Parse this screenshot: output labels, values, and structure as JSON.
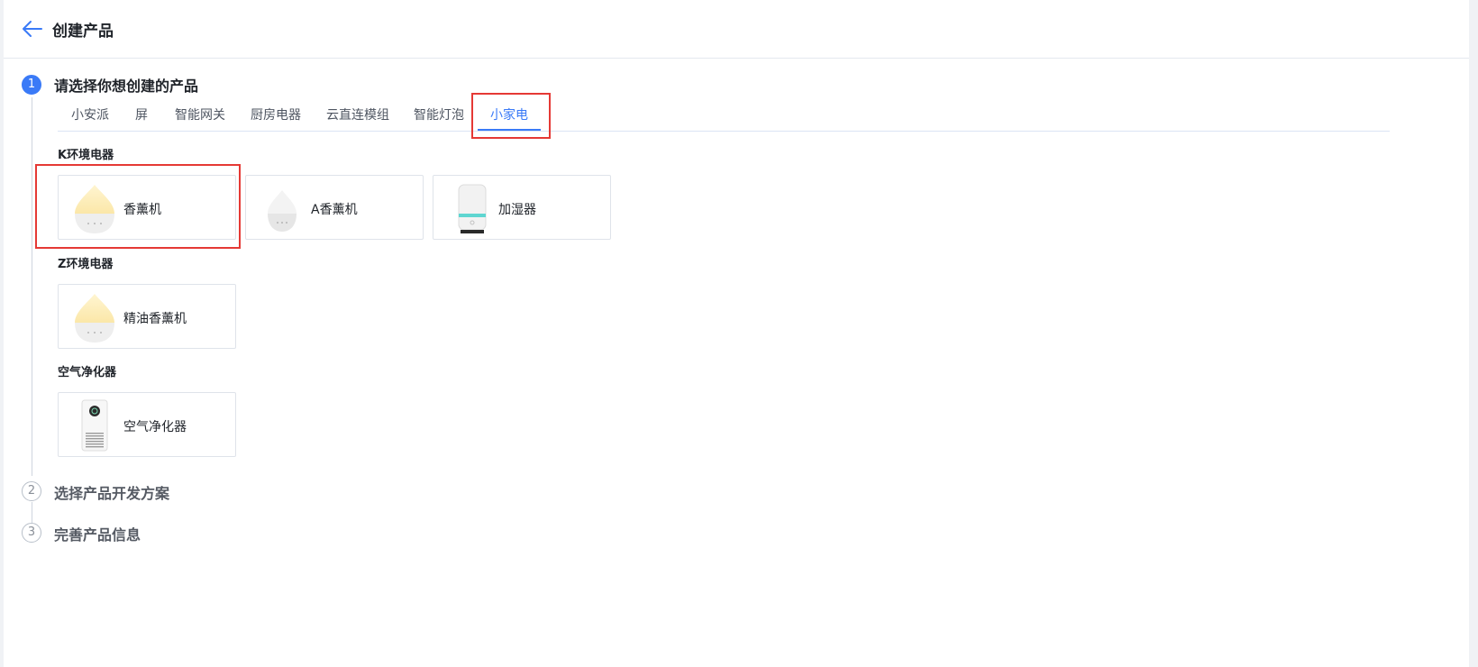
{
  "header": {
    "title": "创建产品"
  },
  "steps": [
    {
      "number": "1",
      "title": "请选择你想创建的产品",
      "state": "active"
    },
    {
      "number": "2",
      "title": "选择产品开发方案",
      "state": "inactive"
    },
    {
      "number": "3",
      "title": "完善产品信息",
      "state": "inactive"
    }
  ],
  "tabs": [
    "小安派",
    "屏",
    "智能网关",
    "厨房电器",
    "云直连模组",
    "智能灯泡",
    "小家电"
  ],
  "active_tab": "小家电",
  "categories": [
    {
      "title": "K环境电器",
      "products": [
        {
          "name": "香薰机",
          "image": "diffuser-warm"
        },
        {
          "name": "A香薰机",
          "image": "diffuser-white"
        },
        {
          "name": "加湿器",
          "image": "humidifier"
        }
      ]
    },
    {
      "title": "Z环境电器",
      "products": [
        {
          "name": "精油香薰机",
          "image": "diffuser-warm"
        }
      ]
    },
    {
      "title": "空气净化器",
      "products": [
        {
          "name": "空气净化器",
          "image": "air-purifier"
        }
      ]
    }
  ],
  "colors": {
    "accent": "#3a7af7",
    "annotation": "#e53935"
  }
}
